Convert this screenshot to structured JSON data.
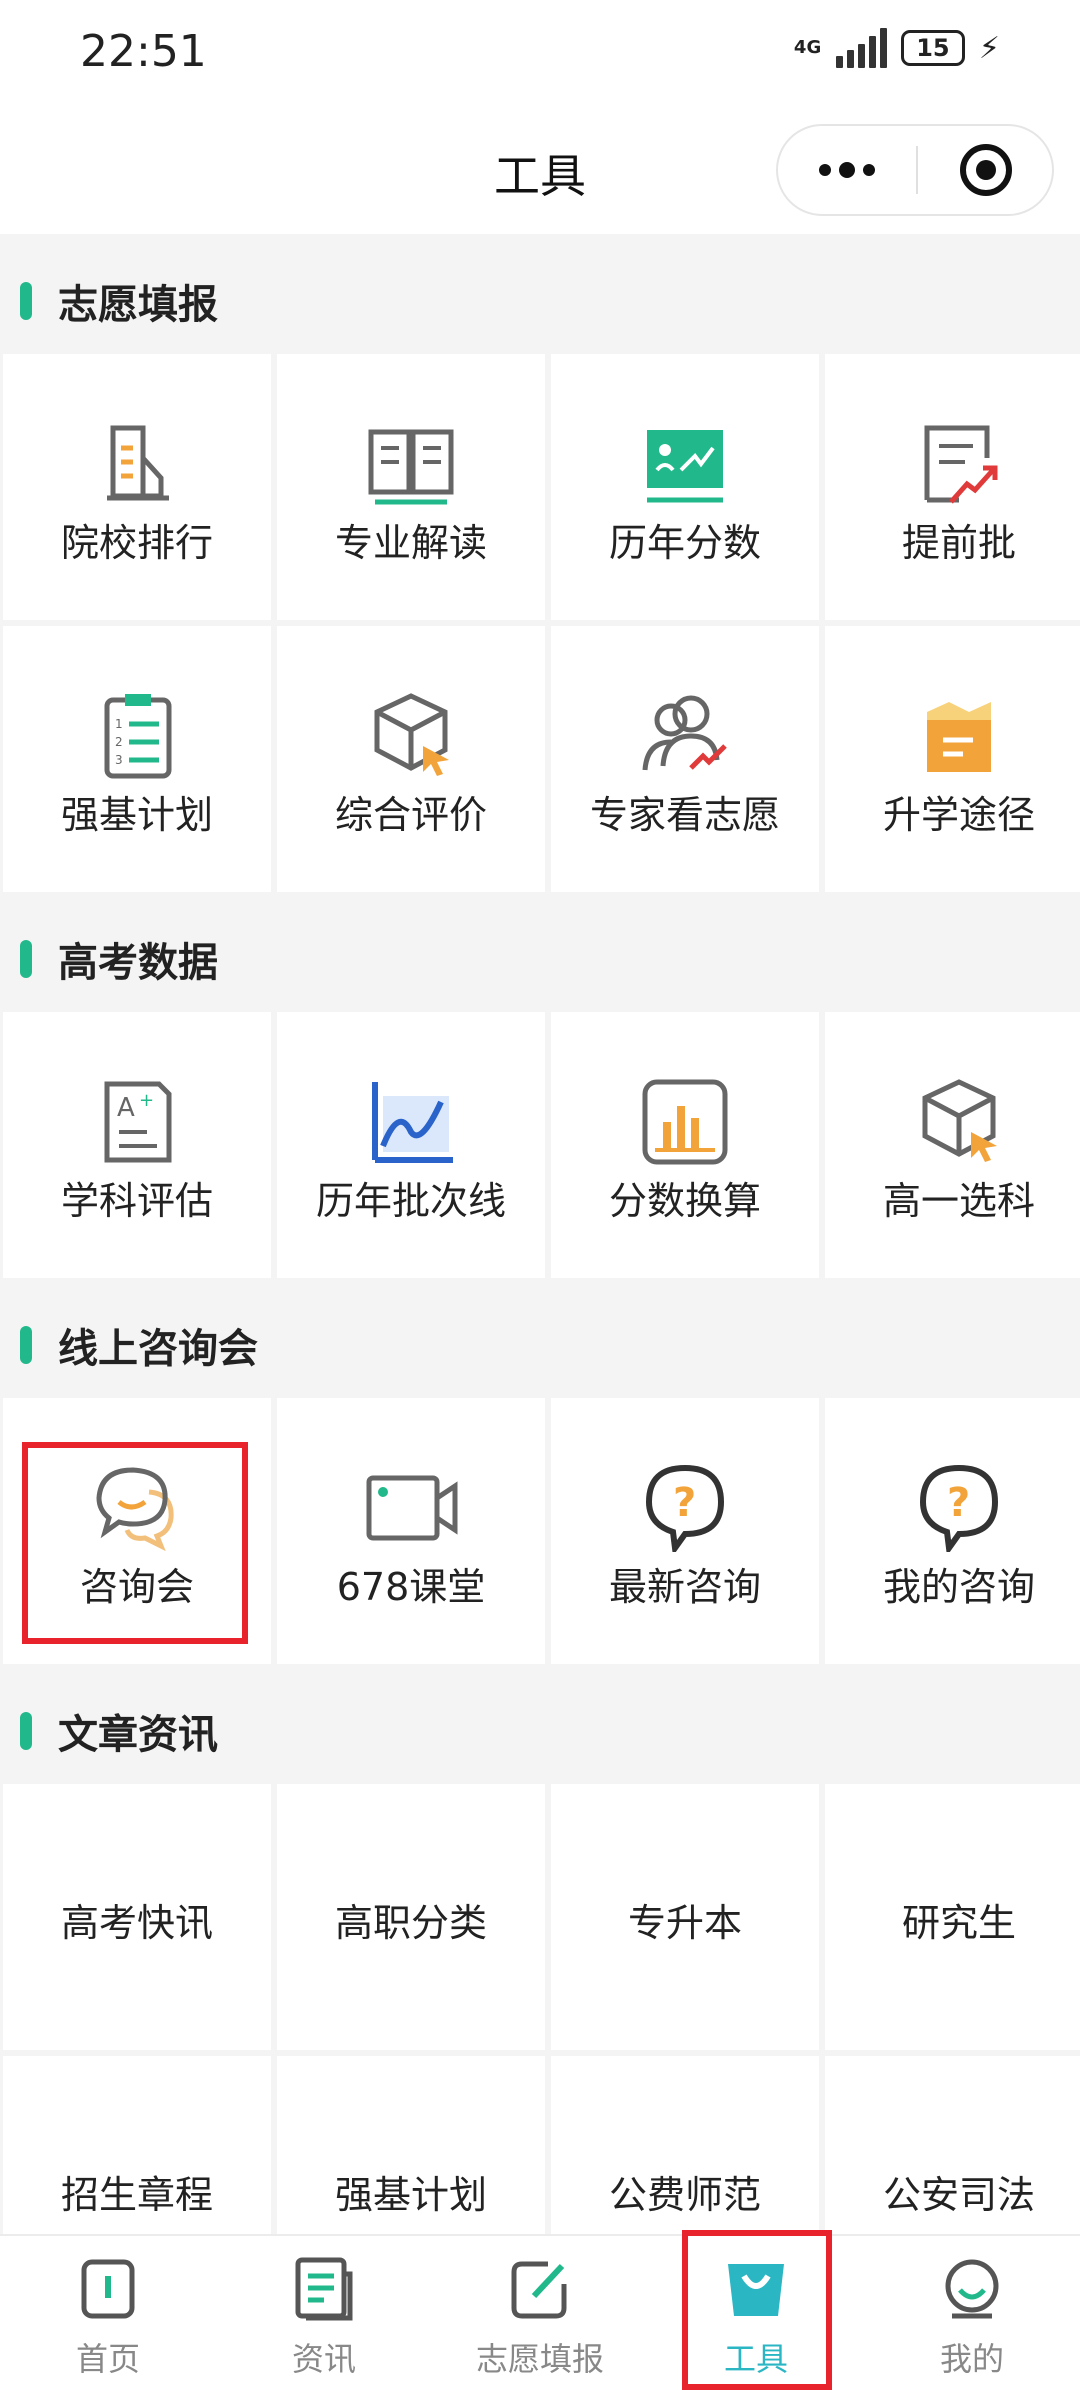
{
  "status_bar": {
    "time": "22:51",
    "network": "4G",
    "battery": "15"
  },
  "nav": {
    "title": "工具"
  },
  "sections": [
    {
      "title": "志愿填报",
      "items": [
        {
          "label": "院校排行",
          "icon": "building-chart-icon"
        },
        {
          "label": "专业解读",
          "icon": "open-book-icon"
        },
        {
          "label": "历年分数",
          "icon": "score-board-icon"
        },
        {
          "label": "提前批",
          "icon": "doc-trend-icon"
        },
        {
          "label": "强基计划",
          "icon": "checklist-icon"
        },
        {
          "label": "综合评价",
          "icon": "cube-cursor-icon"
        },
        {
          "label": "专家看志愿",
          "icon": "experts-icon"
        },
        {
          "label": "升学途径",
          "icon": "folder-path-icon"
        }
      ]
    },
    {
      "title": "高考数据",
      "items": [
        {
          "label": "学科评估",
          "icon": "grade-doc-icon"
        },
        {
          "label": "历年批次线",
          "icon": "line-chart-icon"
        },
        {
          "label": "分数换算",
          "icon": "bar-chart-icon"
        },
        {
          "label": "高一选科",
          "icon": "cube-cursor-icon"
        }
      ]
    },
    {
      "title": "线上咨询会",
      "items": [
        {
          "label": "咨询会",
          "icon": "chat-bubbles-icon"
        },
        {
          "label": "678课堂",
          "icon": "video-camera-icon"
        },
        {
          "label": "最新咨询",
          "icon": "question-bubble-icon"
        },
        {
          "label": "我的咨询",
          "icon": "question-bubble-icon"
        }
      ]
    },
    {
      "title": "文章资讯",
      "items": [
        {
          "label": "高考快讯"
        },
        {
          "label": "高职分类"
        },
        {
          "label": "专升本"
        },
        {
          "label": "研究生"
        },
        {
          "label": "招生章程"
        },
        {
          "label": "强基计划"
        },
        {
          "label": "公费师范"
        },
        {
          "label": "公安司法"
        }
      ]
    }
  ],
  "tabs": [
    {
      "label": "首页",
      "icon": "home-tab-icon"
    },
    {
      "label": "资讯",
      "icon": "news-tab-icon"
    },
    {
      "label": "志愿填报",
      "icon": "edit-tab-icon"
    },
    {
      "label": "工具",
      "icon": "tools-bag-icon",
      "active": true
    },
    {
      "label": "我的",
      "icon": "profile-tab-icon"
    }
  ],
  "colors": {
    "accent": "#21b98b",
    "tab_active": "#2bb6c4",
    "highlight": "#e8232b",
    "icon_orange": "#f2a33a"
  }
}
